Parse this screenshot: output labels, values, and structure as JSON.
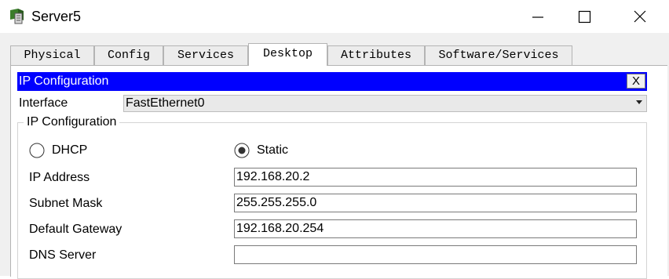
{
  "window": {
    "title": "Server5",
    "app_icon": "packet-tracer-server-icon",
    "controls": [
      "minimize-icon",
      "maximize-icon",
      "close-icon"
    ]
  },
  "tabs": [
    {
      "label": "Physical",
      "active": false
    },
    {
      "label": "Config",
      "active": false
    },
    {
      "label": "Services",
      "active": false
    },
    {
      "label": "Desktop",
      "active": true
    },
    {
      "label": "Attributes",
      "active": false
    },
    {
      "label": "Software/Services",
      "active": false
    }
  ],
  "panel": {
    "title": "IP Configuration",
    "close_label": "X",
    "title_bar_color": "#0000ff"
  },
  "interface": {
    "label": "Interface",
    "value": "FastEthernet0"
  },
  "ip_config": {
    "group_label": "IP Configuration",
    "mode": {
      "dhcp_label": "DHCP",
      "static_label": "Static",
      "selected": "Static"
    },
    "fields": [
      {
        "label": "IP Address",
        "value": "192.168.20.2"
      },
      {
        "label": "Subnet Mask",
        "value": "255.255.255.0"
      },
      {
        "label": "Default Gateway",
        "value": "192.168.20.254"
      },
      {
        "label": "DNS Server",
        "value": ""
      }
    ]
  }
}
